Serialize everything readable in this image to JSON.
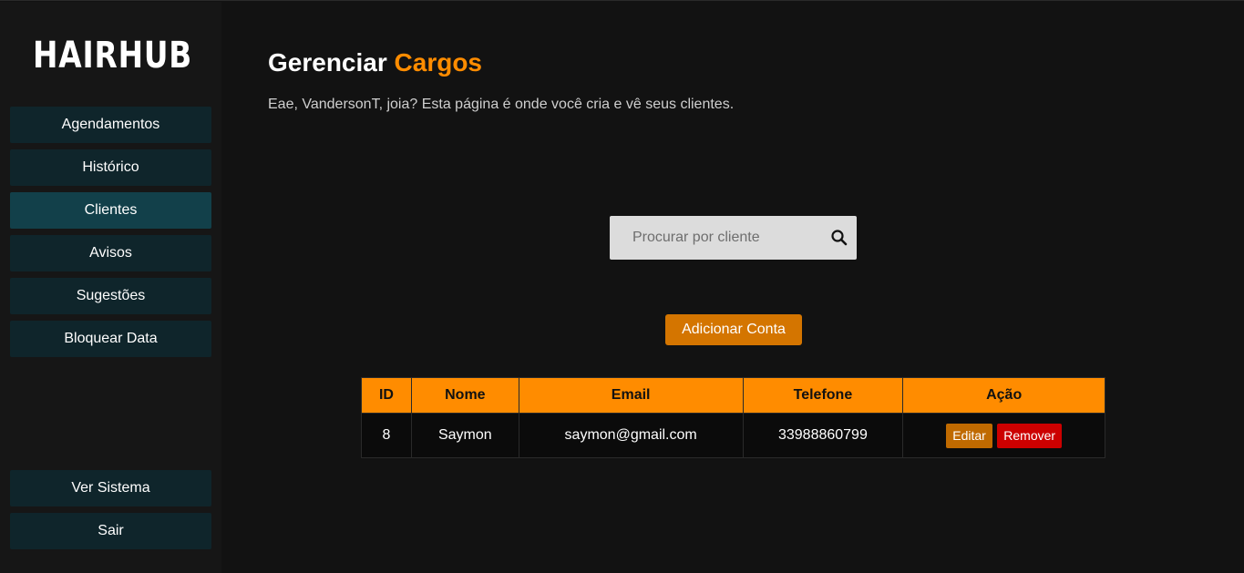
{
  "brand": {
    "name": "HAIRHUB",
    "logo_icon": "bearded-man-icon"
  },
  "sidebar": {
    "items": [
      {
        "label": "Agendamentos"
      },
      {
        "label": "Histórico"
      },
      {
        "label": "Clientes",
        "active": true
      },
      {
        "label": "Avisos"
      },
      {
        "label": "Sugestões"
      },
      {
        "label": "Bloquear Data"
      }
    ],
    "bottom_items": [
      {
        "label": "Ver Sistema"
      },
      {
        "label": "Sair"
      }
    ]
  },
  "main": {
    "title_prefix": "Gerenciar",
    "title_accent": "Cargos",
    "subtitle": "Eae, VandersonT, joia? Esta página é onde você cria e vê seus clientes.",
    "search": {
      "placeholder": "Procurar por cliente",
      "value": "",
      "icon": "search-icon"
    },
    "add_button_label": "Adicionar Conta",
    "table": {
      "headers": [
        "ID",
        "Nome",
        "Email",
        "Telefone",
        "Ação"
      ],
      "rows": [
        {
          "id": "8",
          "nome": "Saymon",
          "email": "saymon@gmail.com",
          "telefone": "33988860799",
          "edit_label": "Editar",
          "remove_label": "Remover"
        }
      ]
    }
  },
  "colors": {
    "accent": "#ff8c00",
    "add_button": "#d47500",
    "edit_button": "#c06a00",
    "remove_button": "#cc0000",
    "nav_item": "#0f252b",
    "nav_item_active": "#12404a",
    "background": "#121212"
  }
}
